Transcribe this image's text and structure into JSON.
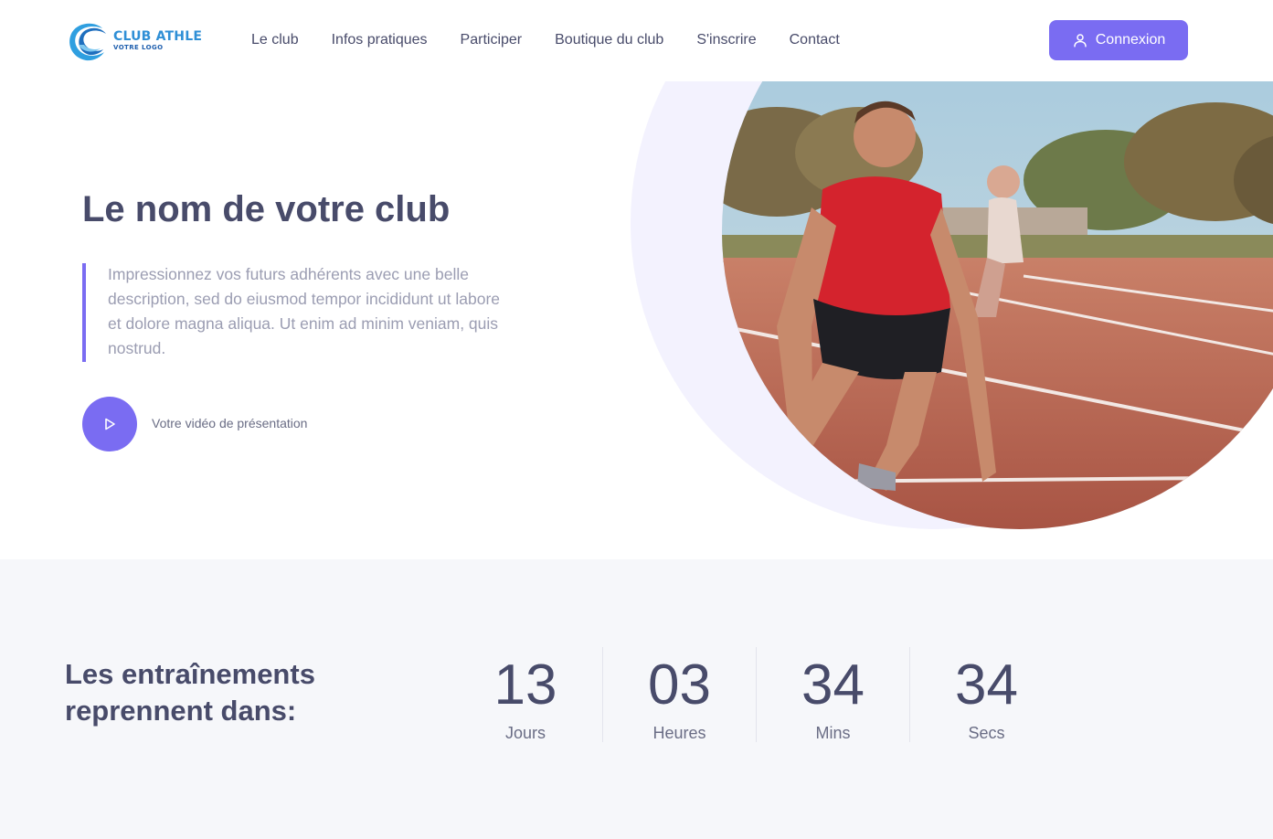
{
  "header": {
    "logo": {
      "title": "CLUB ATHLE",
      "subtitle": "VOTRE LOGO"
    },
    "nav": [
      {
        "label": "Le club"
      },
      {
        "label": "Infos pratiques"
      },
      {
        "label": "Participer"
      },
      {
        "label": "Boutique du club"
      },
      {
        "label": "S'inscrire"
      },
      {
        "label": "Contact"
      }
    ],
    "login_label": "Connexion"
  },
  "hero": {
    "title": "Le nom de votre club",
    "description": "Impressionnez vos futurs adhérents avec une belle description, sed do eiusmod tempor incididunt ut labore et dolore magna aliqua. Ut enim ad minim veniam, quis nostrud.",
    "video_label": "Votre vidéo de présentation"
  },
  "countdown": {
    "title": "Les entraînements reprennent dans:",
    "units": [
      {
        "value": "13",
        "label": "Jours"
      },
      {
        "value": "03",
        "label": "Heures"
      },
      {
        "value": "34",
        "label": "Mins"
      },
      {
        "value": "34",
        "label": "Secs"
      }
    ]
  },
  "colors": {
    "accent": "#7a6cf2",
    "text_dark": "#484b6a",
    "text_muted": "#9b9db2",
    "countdown_bg": "#f6f7fa",
    "crescent": "#f3f2fe"
  },
  "icons": {
    "login": "user-icon",
    "video": "play-icon",
    "logo": "swoosh-logo-icon"
  }
}
